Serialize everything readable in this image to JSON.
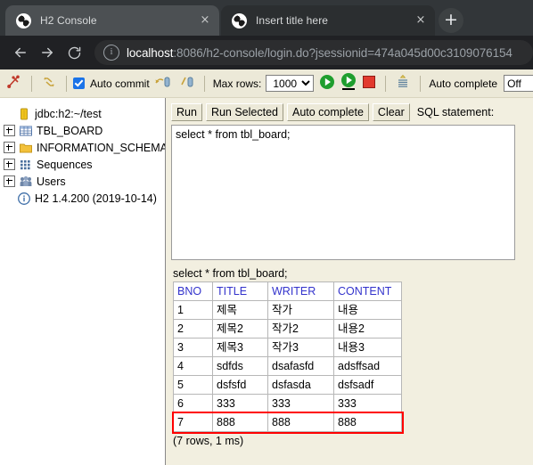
{
  "browser": {
    "tabs": [
      {
        "title": "H2 Console",
        "active": true,
        "favicon": "h2-globe-icon",
        "close": "×"
      },
      {
        "title": "Insert title here",
        "active": false,
        "favicon": "h2-globe-icon",
        "close": "×"
      }
    ],
    "new_tab_label": "+",
    "nav": {
      "back": "back-arrow-icon",
      "forward": "forward-arrow-icon",
      "reload": "reload-icon",
      "site_info": "i"
    },
    "url_host": "localhost",
    "url_rest": ":8086/h2-console/login.do?jsessionid=474a045d00c3109076154"
  },
  "toolbar": {
    "disconnect_icon": "disconnect-icon",
    "refresh_icon": "refresh-icon",
    "auto_commit_label": "Auto commit",
    "auto_commit_checked": true,
    "commit_icon": "commit-icon",
    "rollback_icon": "rollback-icon",
    "max_rows_label": "Max rows:",
    "max_rows_value": "1000",
    "max_rows_options": [
      "1000"
    ],
    "run_icon": "run-icon",
    "run_selected_icon": "run-selected-icon",
    "stop_icon": "stop-icon",
    "history_icon": "history-icon",
    "auto_complete_label": "Auto complete",
    "auto_complete_value": "Off"
  },
  "sidebar": {
    "items": [
      {
        "label": "jdbc:h2:~/test",
        "icon": "database-icon",
        "expandable": false
      },
      {
        "label": "TBL_BOARD",
        "icon": "table-icon",
        "expandable": true
      },
      {
        "label": "INFORMATION_SCHEMA",
        "icon": "folder-icon",
        "expandable": true
      },
      {
        "label": "Sequences",
        "icon": "sequences-icon",
        "expandable": true
      },
      {
        "label": "Users",
        "icon": "users-icon",
        "expandable": true
      },
      {
        "label": "H2 1.4.200 (2019-10-14)",
        "icon": "info-circle-icon",
        "expandable": false
      }
    ]
  },
  "editor": {
    "buttons": {
      "run": "Run",
      "run_selected": "Run Selected",
      "auto_complete": "Auto complete",
      "clear": "Clear"
    },
    "sql_label": "SQL statement:",
    "sql_value": "select * from tbl_board;"
  },
  "result": {
    "query_echo": "select * from tbl_board;",
    "columns": [
      "BNO",
      "TITLE",
      "WRITER",
      "CONTENT"
    ],
    "rows": [
      [
        "1",
        "제목",
        "작가",
        "내용"
      ],
      [
        "2",
        "제목2",
        "작가2",
        "내용2"
      ],
      [
        "3",
        "제목3",
        "작가3",
        "내용3"
      ],
      [
        "4",
        "sdfds",
        "dsafasfd",
        "adsffsad"
      ],
      [
        "5",
        "dsfsfd",
        "dsfasda",
        "dsfsadf"
      ],
      [
        "6",
        "333",
        "333",
        "333"
      ],
      [
        "7",
        "888",
        "888",
        "888"
      ]
    ],
    "highlight_row_index": 6,
    "highlight_color": "#ff0000",
    "footer": "(7 rows, 1 ms)"
  }
}
